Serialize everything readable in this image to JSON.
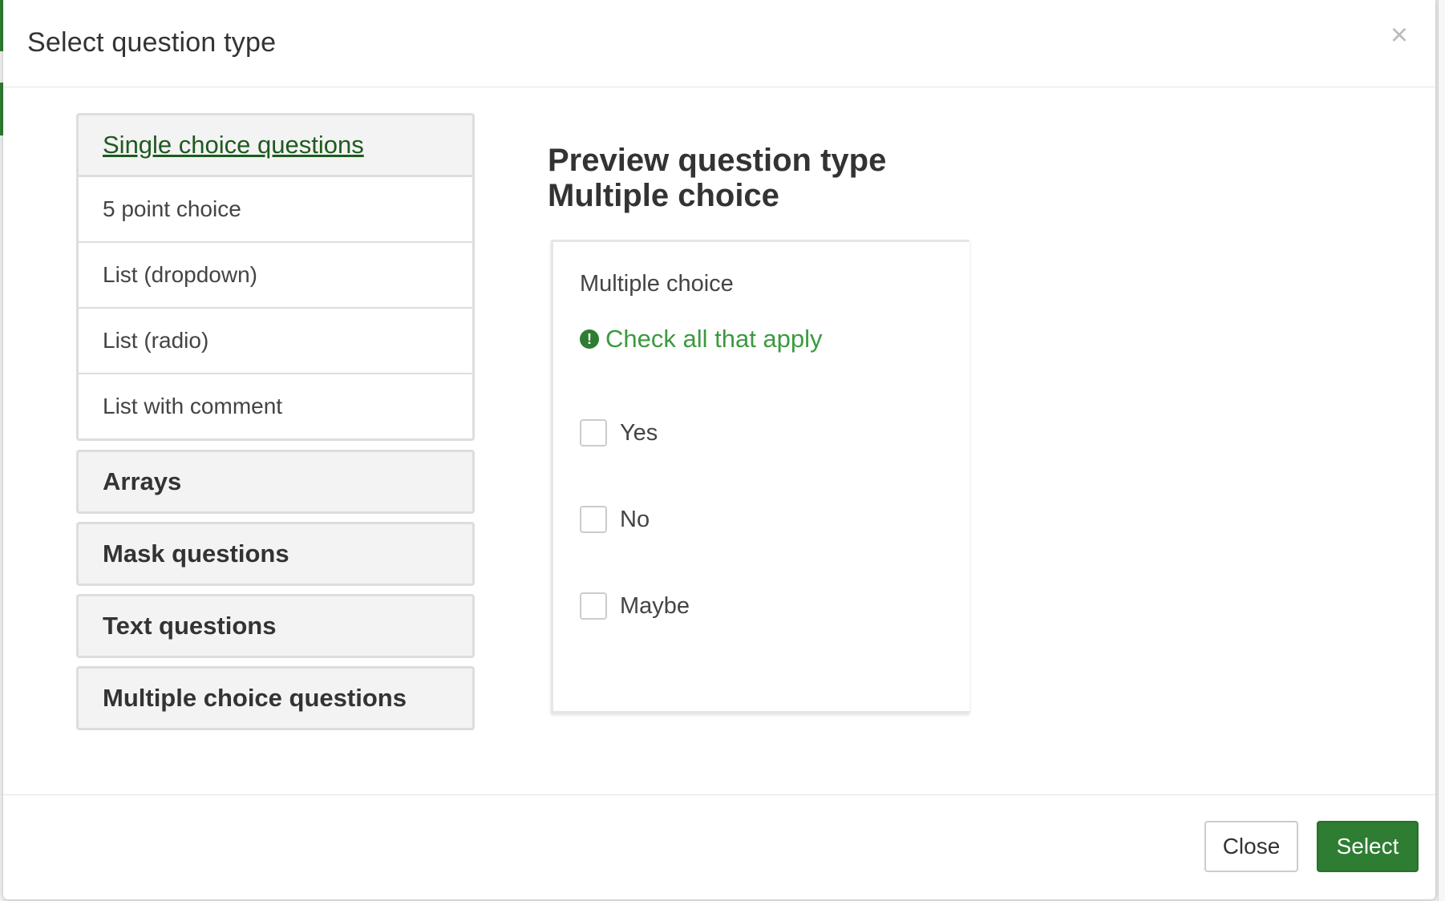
{
  "modal": {
    "title": "Select question type",
    "close_glyph": "×"
  },
  "groups": [
    {
      "label": "Single choice questions",
      "open": true,
      "items": [
        "5 point choice",
        "List (dropdown)",
        "List (radio)",
        "List with comment"
      ]
    },
    {
      "label": "Arrays",
      "open": false
    },
    {
      "label": "Mask questions",
      "open": false
    },
    {
      "label": "Text questions",
      "open": false
    },
    {
      "label": "Multiple choice questions",
      "open": false
    }
  ],
  "preview": {
    "heading_line1": "Preview question type",
    "heading_line2": "Multiple choice",
    "question_label": "Multiple choice",
    "hint": "Check all that apply",
    "hint_icon": "exclamation-circle-icon",
    "answers": [
      "Yes",
      "No",
      "Maybe"
    ]
  },
  "footer": {
    "close_label": "Close",
    "select_label": "Select"
  },
  "colors": {
    "accent": "#2e7d32",
    "hint": "#3b9a3f",
    "active_group_link": "#1e5a1f"
  }
}
